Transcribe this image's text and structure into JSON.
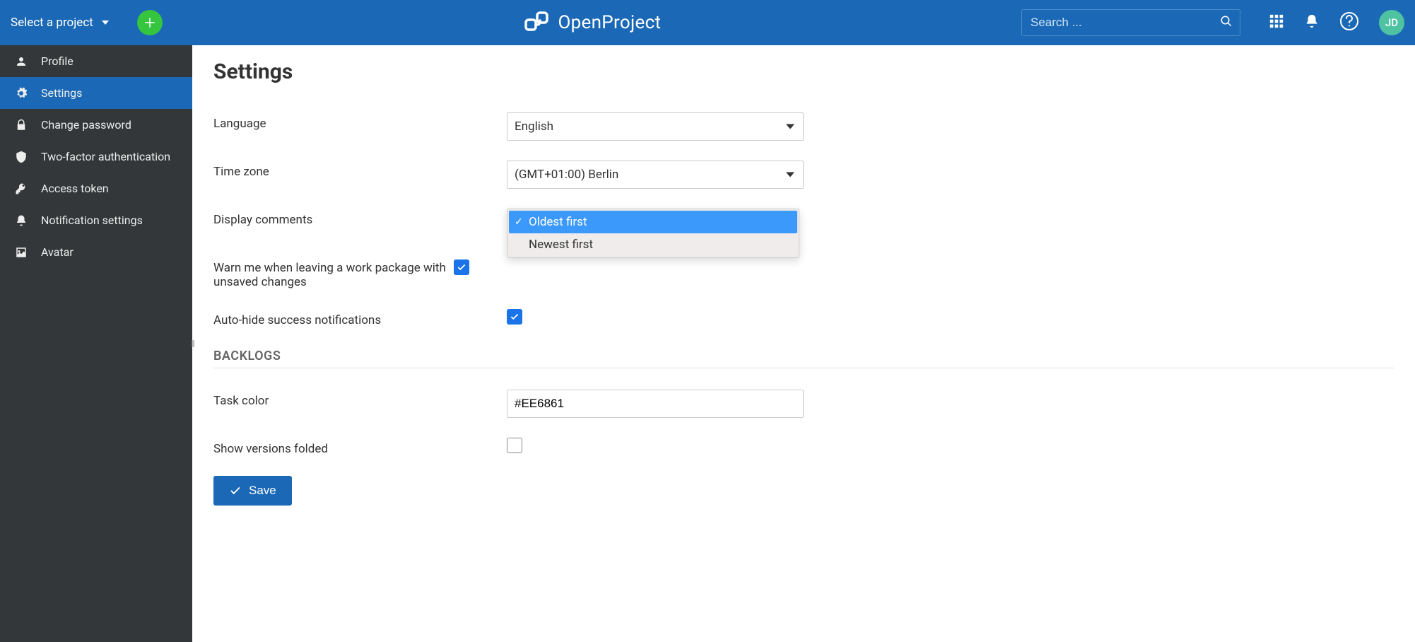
{
  "header": {
    "project_selector_label": "Select a project",
    "brand": "OpenProject",
    "search_placeholder": "Search ...",
    "avatar_initials": "JD"
  },
  "sidebar": {
    "items": [
      {
        "label": "Profile",
        "icon": "user"
      },
      {
        "label": "Settings",
        "icon": "gears",
        "active": true
      },
      {
        "label": "Change password",
        "icon": "lock"
      },
      {
        "label": "Two-factor authentication",
        "icon": "shield-lock"
      },
      {
        "label": "Access token",
        "icon": "key"
      },
      {
        "label": "Notification settings",
        "icon": "bell"
      },
      {
        "label": "Avatar",
        "icon": "image"
      }
    ]
  },
  "page": {
    "title": "Settings",
    "fields": {
      "language": {
        "label": "Language",
        "value": "English"
      },
      "timezone": {
        "label": "Time zone",
        "value": "(GMT+01:00) Berlin"
      },
      "display_comments": {
        "label": "Display comments",
        "options": [
          "Oldest first",
          "Newest first"
        ],
        "selected": "Oldest first"
      },
      "warn_unsaved": {
        "label": "Warn me when leaving a work package with unsaved changes",
        "checked": true
      },
      "auto_hide": {
        "label": "Auto-hide success notifications",
        "checked": true
      }
    },
    "backlogs": {
      "heading": "BACKLOGS",
      "task_color": {
        "label": "Task color",
        "value": "#EE6861"
      },
      "show_versions_folded": {
        "label": "Show versions folded",
        "checked": false
      }
    },
    "save_label": "Save"
  }
}
